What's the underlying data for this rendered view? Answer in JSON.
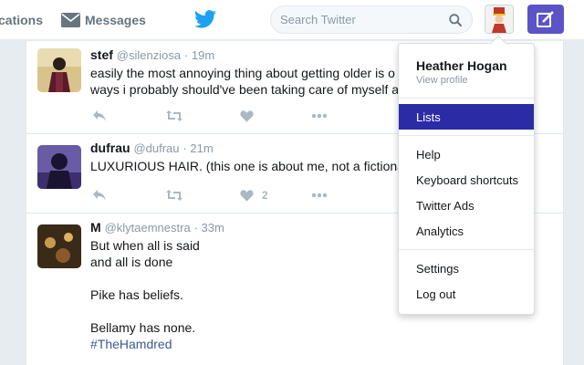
{
  "topbar": {
    "notifications_label": "cations",
    "messages_label": "Messages",
    "search_placeholder": "Search Twitter",
    "icons": {
      "messages": "envelope-icon",
      "logo": "twitter-bird-icon",
      "search": "search-icon",
      "compose": "compose-tweet-icon"
    },
    "colors": {
      "compose_button": "#5b53c6",
      "logo": "#1da1f2"
    }
  },
  "tweets": [
    {
      "name": "stef",
      "handle": "@silenziosa",
      "time": "19m",
      "lines": [
        "easily the most annoying thing about getting older is o",
        "ways i probably should've been taking care of myself a"
      ],
      "likes": ""
    },
    {
      "name": "dufrau",
      "handle": "@dufrau",
      "time": "21m",
      "lines": [
        "LUXURIOUS HAIR. (this one is about me, not a fictiona"
      ],
      "likes": "2"
    },
    {
      "name": "M",
      "handle": "@klytaemnestra",
      "time": "33m",
      "lines": [
        "But when all is said",
        "and all is done",
        "",
        "Pike has beliefs.",
        "",
        "Bellamy has none."
      ],
      "hashtag": "#TheHamdred"
    }
  ],
  "dropdown": {
    "user_name": "Heather Hogan",
    "view_profile": "View profile",
    "items": [
      {
        "label": "Lists",
        "active": true
      },
      {
        "label": "Help"
      },
      {
        "label": "Keyboard shortcuts"
      },
      {
        "label": "Twitter Ads"
      },
      {
        "label": "Analytics"
      },
      {
        "label": "Settings"
      },
      {
        "label": "Log out"
      }
    ],
    "colors": {
      "active_item": "#2b2ba6"
    }
  }
}
